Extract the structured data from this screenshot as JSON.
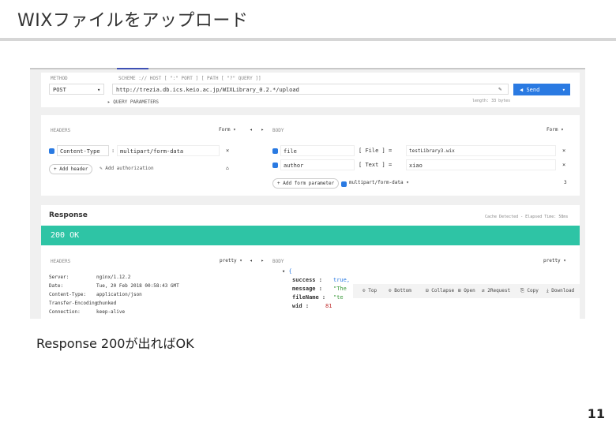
{
  "slide": {
    "title": "WIXファイルをアップロード",
    "caption": "Response 200が出ればOK",
    "page_number": "11"
  },
  "request": {
    "method_label": "METHOD",
    "scheme_label": "SCHEME :// HOST [ \":\" PORT ] [ PATH [ \"?\" QUERY ]]",
    "method": "POST",
    "url": "http://trezia.db.ics.keio.ac.jp/WIXLibrary_0.2.*/upload",
    "send_label": "Send",
    "length_info": "length: 33 bytes",
    "query_params_label": "QUERY PARAMETERS"
  },
  "headers": {
    "label": "HEADERS",
    "mode": "Form",
    "rows": [
      {
        "name": "Content-Type",
        "value": "multipart/form-data"
      }
    ],
    "add_header": "+ Add header",
    "add_authorization": "Add authorization"
  },
  "body": {
    "label": "BODY",
    "mode": "Form",
    "rows": [
      {
        "name": "file",
        "type": "File",
        "value": "testLibrary3.wix"
      },
      {
        "name": "author",
        "type": "Text",
        "value": "xiao"
      }
    ],
    "add_form_parameter": "+ Add form parameter",
    "encoding": "multipart/form-data"
  },
  "response": {
    "title": "Response",
    "actions": "Cache Detected - Elapsed Time: 58ms",
    "status": "200 OK",
    "headers_label": "HEADERS",
    "body_label": "BODY",
    "view_mode": "pretty",
    "header_rows": [
      {
        "name": "Server:",
        "value": "nginx/1.12.2"
      },
      {
        "name": "Date:",
        "value": "Tue, 20 Feb 2018 00:58:43 GMT"
      },
      {
        "name": "Content-Type:",
        "value": "application/json"
      },
      {
        "name": "Transfer-Encoding:",
        "value": "chunked"
      },
      {
        "name": "Connection:",
        "value": "keep-alive"
      }
    ],
    "body_open": "{",
    "body_rows": [
      {
        "key": "success :",
        "value": "true,"
      },
      {
        "key": "message :",
        "value": "\"The"
      },
      {
        "key": "fileName :",
        "value": "\"te"
      },
      {
        "key": "wid :",
        "value": "81"
      }
    ],
    "toolbar": [
      "Top",
      "Bottom",
      "Collapse",
      "Open",
      "2Request",
      "Copy",
      "Download"
    ]
  }
}
